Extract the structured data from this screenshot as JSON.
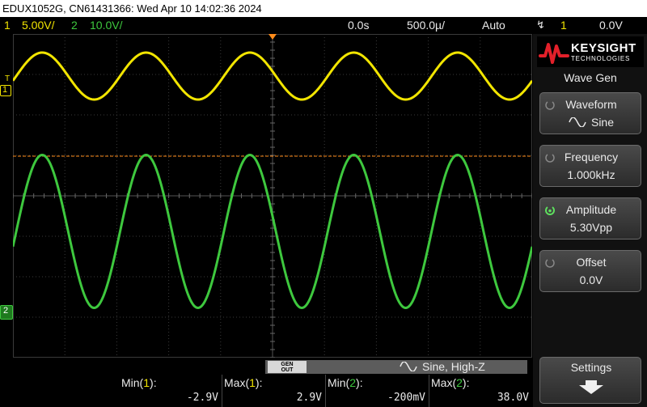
{
  "title_bar": {
    "text": "EDUX1052G, CN61431366: Wed Apr 10 14:02:36 2024"
  },
  "status_bar": {
    "ch1_num": "1",
    "ch1_scale": "5.00V/",
    "ch2_num": "2",
    "ch2_scale": "10.0V/",
    "time_delay": "0.0s",
    "time_scale": "500.0µ/",
    "trigger_mode": "Auto",
    "trigger_source": "1",
    "trigger_level": "0.0V",
    "trigger_icon": "trigger-edge-icon"
  },
  "markers": {
    "ch1": "1",
    "ch2": "2",
    "trigger": "T"
  },
  "colors": {
    "ch1": "#f2e500",
    "ch2": "#3ec83e",
    "grid": "#3a3a3a",
    "trigger_line": "#ff8c1a"
  },
  "logo": {
    "name": "KEYSIGHT",
    "subtitle": "TECHNOLOGIES"
  },
  "wave_gen": {
    "title": "Wave Gen",
    "waveform_label": "Waveform",
    "waveform_value": "Sine",
    "frequency_label": "Frequency",
    "frequency_value": "1.000kHz",
    "amplitude_label": "Amplitude",
    "amplitude_value": "5.30Vpp",
    "offset_label": "Offset",
    "offset_value": "0.0V",
    "settings_label": "Settings"
  },
  "gen_out": {
    "label_line1": "GEN",
    "label_line2": "OUT",
    "text": "Sine, High-Z"
  },
  "measurements": [
    {
      "name_prefix": "Min(",
      "channel": "1",
      "name_suffix": "):",
      "value": "-2.9V"
    },
    {
      "name_prefix": "Max(",
      "channel": "1",
      "name_suffix": "):",
      "value": "2.9V"
    },
    {
      "name_prefix": "Min(",
      "channel": "2",
      "name_suffix": "):",
      "value": "-200mV"
    },
    {
      "name_prefix": "Max(",
      "channel": "2",
      "name_suffix": "):",
      "value": "38.0V"
    }
  ],
  "traces": {
    "ch1": {
      "cycles": 5,
      "amplitude_div": 0.58,
      "center_div": 1.04
    },
    "ch2": {
      "cycles": 5,
      "amplitude_div": 1.89,
      "center_div": 4.88
    }
  }
}
